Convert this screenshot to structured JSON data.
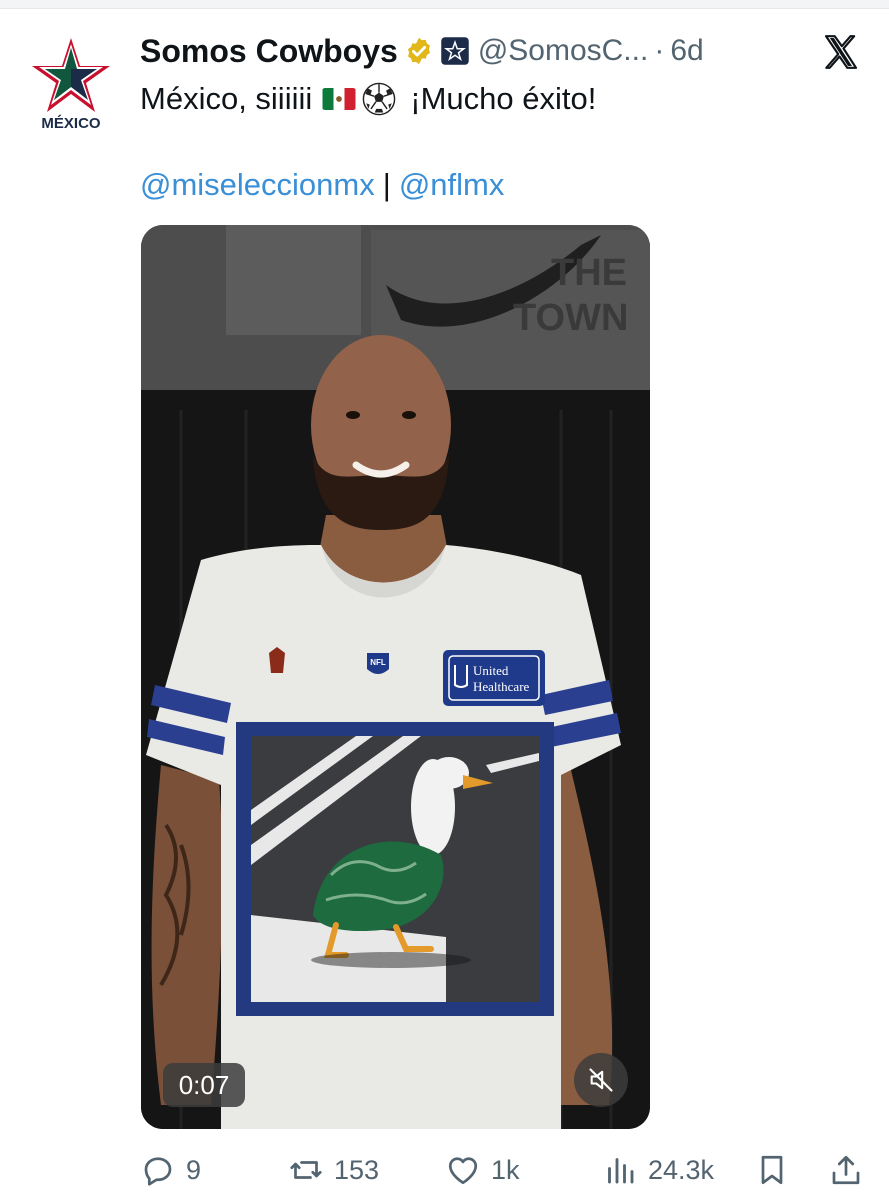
{
  "tweet": {
    "display_name": "Somos Cowboys",
    "handle": "@SomosC...",
    "separator": "·",
    "age": "6d",
    "text_part1": "México, siiiiii",
    "text_part2": "¡Mucho éxito!",
    "mentions": [
      "@miseleccionmx",
      "@nflmx"
    ],
    "mention_separator": "|"
  },
  "avatar": {
    "label": "MÉXICO",
    "star_color": "#1b2b48",
    "accent": "#c8102e",
    "green": "#0b6b3a"
  },
  "video": {
    "time": "0:07",
    "wall_text_1": "THE",
    "wall_text_2": "TOWN",
    "jersey_sponsor_1": "United",
    "jersey_sponsor_2": "Healthcare",
    "jersey_badge": "NFL"
  },
  "actions": {
    "replies": "9",
    "retweets": "153",
    "likes": "1k",
    "views": "24.3k"
  },
  "icons": {
    "verified": "verified-badge-icon",
    "affiliate": "affiliate-star-icon",
    "logo": "x-logo-icon",
    "flag": "mexico-flag-emoji",
    "ball": "soccer-ball-emoji",
    "mute": "muted-speaker-icon",
    "reply": "reply-icon",
    "retweet": "retweet-icon",
    "like": "heart-icon",
    "views": "views-chart-icon",
    "bookmark": "bookmark-icon",
    "share": "share-icon"
  },
  "colors": {
    "link": "#3a8fd6",
    "muted": "#536471",
    "verified_gold": "#e2b719"
  }
}
